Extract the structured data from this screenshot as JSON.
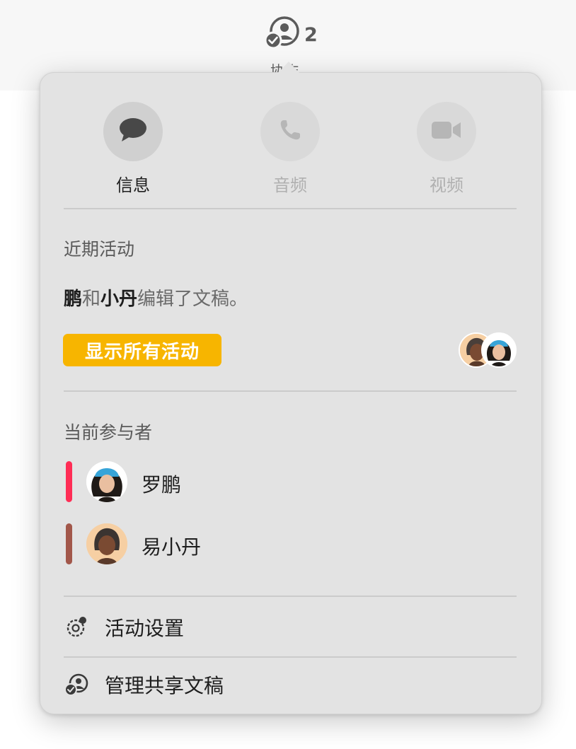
{
  "toolbar": {
    "collab_count": "2",
    "collab_label": "协作"
  },
  "communication": {
    "message": {
      "label": "信息",
      "icon": "speech-bubble-icon",
      "enabled": true
    },
    "audio": {
      "label": "音频",
      "icon": "phone-icon",
      "enabled": false
    },
    "video": {
      "label": "视频",
      "icon": "video-camera-icon",
      "enabled": false
    }
  },
  "recent_activity": {
    "title": "近期活动",
    "user1": "鹏",
    "conj": "和",
    "user2": "小丹",
    "action": "编辑了文稿。",
    "show_all_button": "显示所有活动"
  },
  "participants": {
    "title": "当前参与者",
    "list": [
      {
        "name": "罗鹏",
        "color": "#ff2d55"
      },
      {
        "name": "易小丹",
        "color": "#a2574a"
      }
    ]
  },
  "menu": {
    "activity_settings": "活动设置",
    "manage_shared": "管理共享文稿"
  },
  "colors": {
    "accent_button": "#f7b500",
    "popover_bg": "#e3e3e3"
  }
}
